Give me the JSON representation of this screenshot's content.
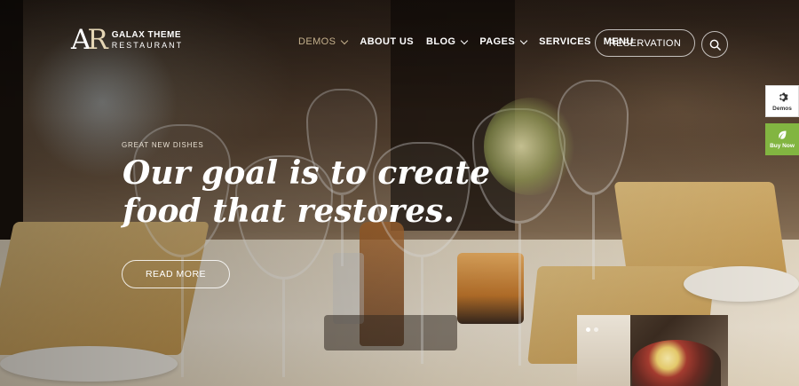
{
  "logo": {
    "mark": "AR",
    "name": "GALAX THEME",
    "sub": "RESTAURANT"
  },
  "nav": {
    "items": [
      {
        "label": "DEMOS",
        "has_dropdown": true,
        "active": true
      },
      {
        "label": "ABOUT US",
        "has_dropdown": false
      },
      {
        "label": "BLOG",
        "has_dropdown": true
      },
      {
        "label": "PAGES",
        "has_dropdown": true
      },
      {
        "label": "SERVICES",
        "has_dropdown": false
      },
      {
        "label": "MENU",
        "has_dropdown": false
      }
    ],
    "reservation_label": "RESERVATION",
    "search_icon": "search-icon"
  },
  "hero": {
    "eyebrow": "GREAT NEW DISHES",
    "headline_line1": "Our goal is to create",
    "headline_line2": "food that restores.",
    "cta_label": "READ MORE"
  },
  "side_widgets": {
    "demos_label": "Demos",
    "demos_icon": "gear-icon",
    "buy_label": "Buy Now",
    "buy_icon": "leaf-icon"
  },
  "preview": {
    "slides": 2,
    "active_slide": 1
  },
  "colors": {
    "accent_muted": "#c4b08c",
    "buy_green": "#82b541",
    "white": "#ffffff"
  }
}
